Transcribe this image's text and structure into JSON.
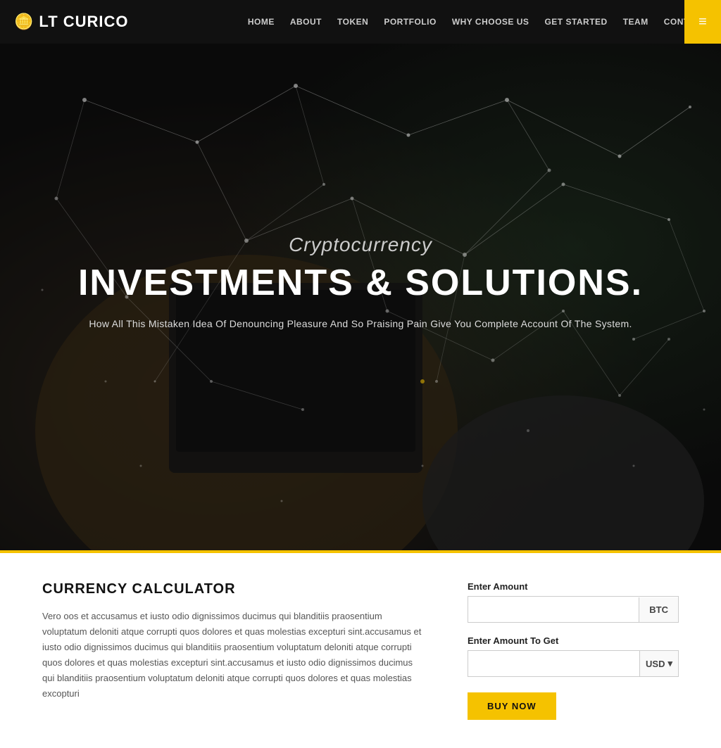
{
  "header": {
    "logo_icon": "🪙",
    "logo_brand": "LT",
    "logo_name": " CURICO",
    "nav_items": [
      {
        "label": "HOME",
        "href": "#"
      },
      {
        "label": "ABOUT",
        "href": "#"
      },
      {
        "label": "TOKEN",
        "href": "#"
      },
      {
        "label": "PORTFOLIO",
        "href": "#"
      },
      {
        "label": "WHY CHOOSE US",
        "href": "#"
      },
      {
        "label": "GET STARTED",
        "href": "#"
      },
      {
        "label": "TEAM",
        "href": "#"
      },
      {
        "label": "CONTACT",
        "href": "#"
      }
    ],
    "hamburger_label": "≡"
  },
  "hero": {
    "subtitle": "Cryptocurrency",
    "title": "INVESTMENTS & SOLUTIONS.",
    "description": "How All This Mistaken Idea Of Denouncing Pleasure And So Praising Pain Give You Complete Account Of The System."
  },
  "calculator": {
    "title": "CURRENCY CALCULATOR",
    "description": "Vero oos et accusamus et iusto odio dignissimos ducimus qui blanditiis praosentium voluptatum deloniti atque corrupti quos dolores et quas molestias excepturi sint.accusamus et iusto odio dignissimos ducimus qui blanditiis praosentium voluptatum deloniti atque corrupti quos dolores et quas molestias excepturi sint.accusamus et iusto odio dignissimos ducimus qui blanditiis praosentium voluptatum deloniti atque corrupti quos dolores et quas molestias excopturi",
    "enter_amount_label": "Enter Amount",
    "amount_currency": "BTC",
    "enter_get_label": "Enter Amount To Get",
    "get_currency": "USD",
    "buy_button_label": "BUY NOW",
    "amount_placeholder": "",
    "get_placeholder": ""
  }
}
